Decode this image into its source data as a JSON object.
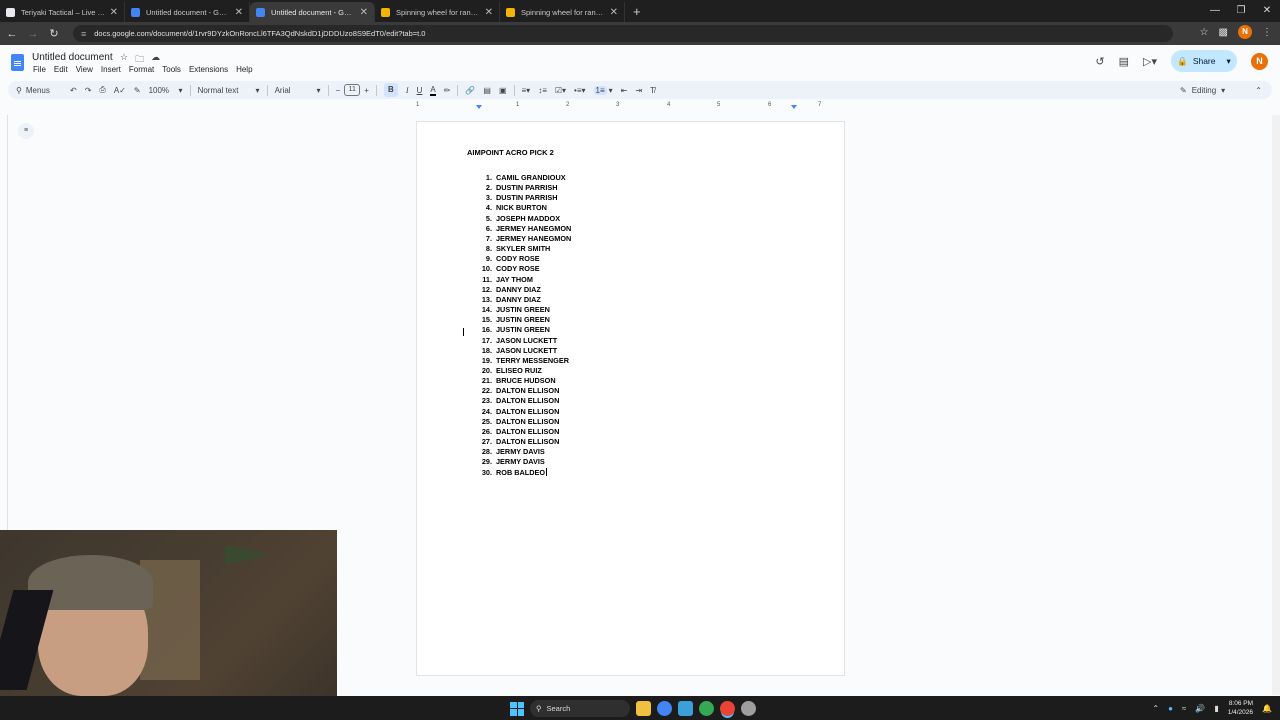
{
  "browser": {
    "tabs": [
      {
        "title": "Teriyaki Tactical – Live Tactical Wi...",
        "color": "#e8eaed",
        "active": false
      },
      {
        "title": "Untitled document - Google Docs",
        "color": "#4285f4",
        "active": false
      },
      {
        "title": "Untitled document - Google Docs",
        "color": "#4285f4",
        "active": true
      },
      {
        "title": "Spinning wheel for random choic...",
        "color": "#f4b400",
        "active": false
      },
      {
        "title": "Spinning wheel for random choic...",
        "color": "#f4b400",
        "active": false
      }
    ],
    "url": "docs.google.com/document/d/1rvr9DYzkOnRoncLl6TFA3QdNskdD1jDDDUzo8S9EdT0/edit?tab=t.0",
    "profile_initial": "N"
  },
  "docs": {
    "title": "Untitled document",
    "menu": [
      "File",
      "Edit",
      "View",
      "Insert",
      "Format",
      "Tools",
      "Extensions",
      "Help"
    ],
    "share_label": "Share",
    "profile_initial": "N"
  },
  "toolbar": {
    "menus_label": "Menus",
    "zoom": "100%",
    "style": "Normal text",
    "font": "Arial",
    "font_size": "11",
    "mode": "Editing"
  },
  "ruler": {
    "ticks": [
      "1",
      "1",
      "2",
      "3",
      "4",
      "5",
      "6",
      "7"
    ]
  },
  "document": {
    "heading": "AIMPOINT ACRO PICK 2",
    "entries": [
      {
        "num": "1.",
        "name": "CAMIL GRANDIOUX"
      },
      {
        "num": "2.",
        "name": "DUSTIN PARRISH"
      },
      {
        "num": "3.",
        "name": "DUSTIN PARRISH"
      },
      {
        "num": "4.",
        "name": "NICK BURTON"
      },
      {
        "num": "5.",
        "name": "JOSEPH MADDOX"
      },
      {
        "num": "6.",
        "name": "JERMEY HANEGMON"
      },
      {
        "num": "7.",
        "name": "JERMEY HANEGMON"
      },
      {
        "num": "8.",
        "name": "SKYLER SMITH"
      },
      {
        "num": "9.",
        "name": "CODY ROSE"
      },
      {
        "num": "10.",
        "name": "CODY ROSE"
      },
      {
        "num": "11.",
        "name": "JAY THOM"
      },
      {
        "num": "12.",
        "name": "DANNY DIAZ"
      },
      {
        "num": "13.",
        "name": "DANNY DIAZ"
      },
      {
        "num": "14.",
        "name": "JUSTIN GREEN"
      },
      {
        "num": "15.",
        "name": "JUSTIN GREEN"
      },
      {
        "num": "16.",
        "name": "JUSTIN GREEN"
      },
      {
        "num": "17.",
        "name": "JASON LUCKETT"
      },
      {
        "num": "18.",
        "name": "JASON LUCKETT"
      },
      {
        "num": "19.",
        "name": "TERRY MESSENGER"
      },
      {
        "num": "20.",
        "name": "ELISEO RUIZ"
      },
      {
        "num": "21.",
        "name": "BRUCE HUDSON"
      },
      {
        "num": "22.",
        "name": "DALTON ELLISON"
      },
      {
        "num": "23.",
        "name": "DALTON ELLISON"
      },
      {
        "num": "24.",
        "name": "DALTON ELLISON"
      },
      {
        "num": "25.",
        "name": "DALTON ELLISON"
      },
      {
        "num": "26.",
        "name": "DALTON ELLISON"
      },
      {
        "num": "27.",
        "name": "DALTON ELLISON"
      },
      {
        "num": "28.",
        "name": "JERMY DAVIS"
      },
      {
        "num": "29.",
        "name": "JERMY DAVIS"
      },
      {
        "num": "30.",
        "name": "ROB BALDEO"
      }
    ]
  },
  "taskbar": {
    "search_label": "Search",
    "time": "8:06 PM",
    "date": "1/4/2026"
  }
}
